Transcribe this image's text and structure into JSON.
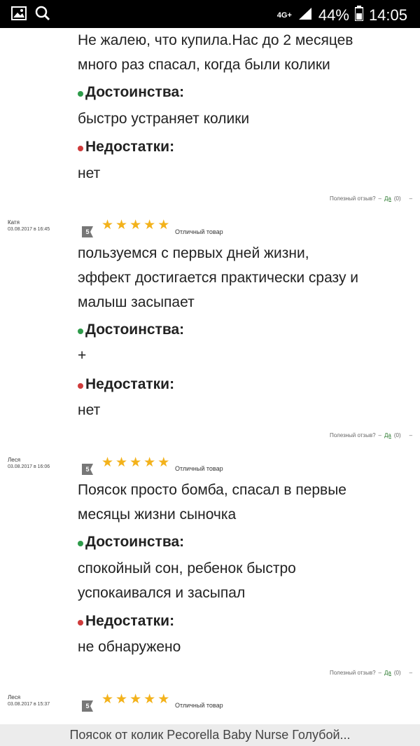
{
  "status_bar": {
    "network": "4G+",
    "battery": "44%",
    "time": "14:05"
  },
  "first_review": {
    "text": [
      "Не жалею, что купила.Нас до 2 месяцев",
      "много раз спасал, когда были колики"
    ],
    "pros_title": "Достоинства:",
    "pros": [
      "быстро устраняет колики"
    ],
    "cons_title": "Недостатки:",
    "cons": [
      "нет"
    ],
    "helpful": {
      "label": "Полезный отзыв?",
      "sep": "–",
      "yes": "Да",
      "count": "(0)",
      "tail": "–"
    }
  },
  "reviews": [
    {
      "author": "Катя",
      "date": "03.08.2017 в 16:45",
      "rating": "5",
      "rating_label": "Отличный товар",
      "text": [
        "пользуемся с первых дней жизни,",
        "эффект достигается практически сразу и",
        "малыш засыпает"
      ],
      "pros_title": "Достоинства:",
      "pros": [
        "+"
      ],
      "cons_title": "Недостатки:",
      "cons": [
        "нет"
      ],
      "helpful": {
        "label": "Полезный отзыв?",
        "sep": "–",
        "yes": "Да",
        "count": "(0)",
        "tail": "–"
      }
    },
    {
      "author": "Леся",
      "date": "03.08.2017 в 16:06",
      "rating": "5",
      "rating_label": "Отличный товар",
      "text": [
        "Поясок просто бомба, спасал в первые",
        "месяцы жизни сыночка"
      ],
      "pros_title": "Достоинства:",
      "pros": [
        "спокойный сон, ребенок быстро",
        "успокаивался и засыпал"
      ],
      "cons_title": "Недостатки:",
      "cons": [
        "не обнаружено"
      ],
      "helpful": {
        "label": "Полезный отзыв?",
        "sep": "–",
        "yes": "Да",
        "count": "(0)",
        "tail": "–"
      }
    },
    {
      "author": "Леся",
      "date": "03.08.2017 в 15:37",
      "rating": "5",
      "rating_label": "Отличный товар"
    }
  ],
  "bottom_bar": {
    "title": "Поясок от колик Pecorella Baby Nurse Голубой..."
  },
  "icons": {
    "gallery": "image-icon",
    "search": "search-icon",
    "signal": "signal-icon",
    "battery": "battery-icon"
  },
  "colors": {
    "star": "#f3b21b",
    "pros_dot": "#2e9b4a",
    "cons_dot": "#cf3b3b",
    "link": "#2e7d32"
  }
}
